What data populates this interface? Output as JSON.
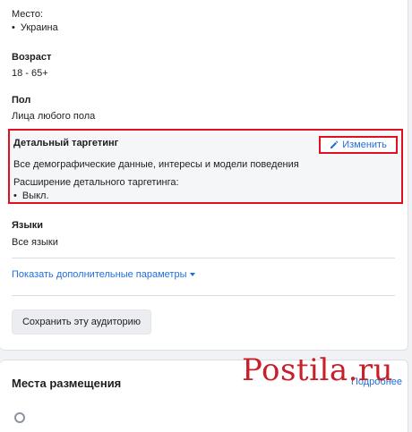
{
  "location": {
    "label": "Место:",
    "items": [
      "Украина"
    ]
  },
  "age": {
    "label": "Возраст",
    "value": "18 - 65+"
  },
  "gender": {
    "label": "Пол",
    "value": "Лица любого пола"
  },
  "detailed_targeting": {
    "title": "Детальный таргетинг",
    "edit_label": "Изменить",
    "description": "Все демографические данные, интересы и модели поведения",
    "expansion_label": "Расширение детального таргетинга:",
    "expansion_items": [
      "Выкл."
    ]
  },
  "languages": {
    "label": "Языки",
    "value": "Все языки"
  },
  "more_options_label": "Показать дополнительные параметры",
  "save_audience_label": "Сохранить эту аудиторию",
  "placements": {
    "title": "Места размещения",
    "link_label": "Подробнее"
  },
  "watermark": {
    "text": "Postila.ru"
  },
  "colors": {
    "accent": "#216fdb",
    "highlight_border": "#e0111e",
    "watermark": "#c8202a"
  }
}
